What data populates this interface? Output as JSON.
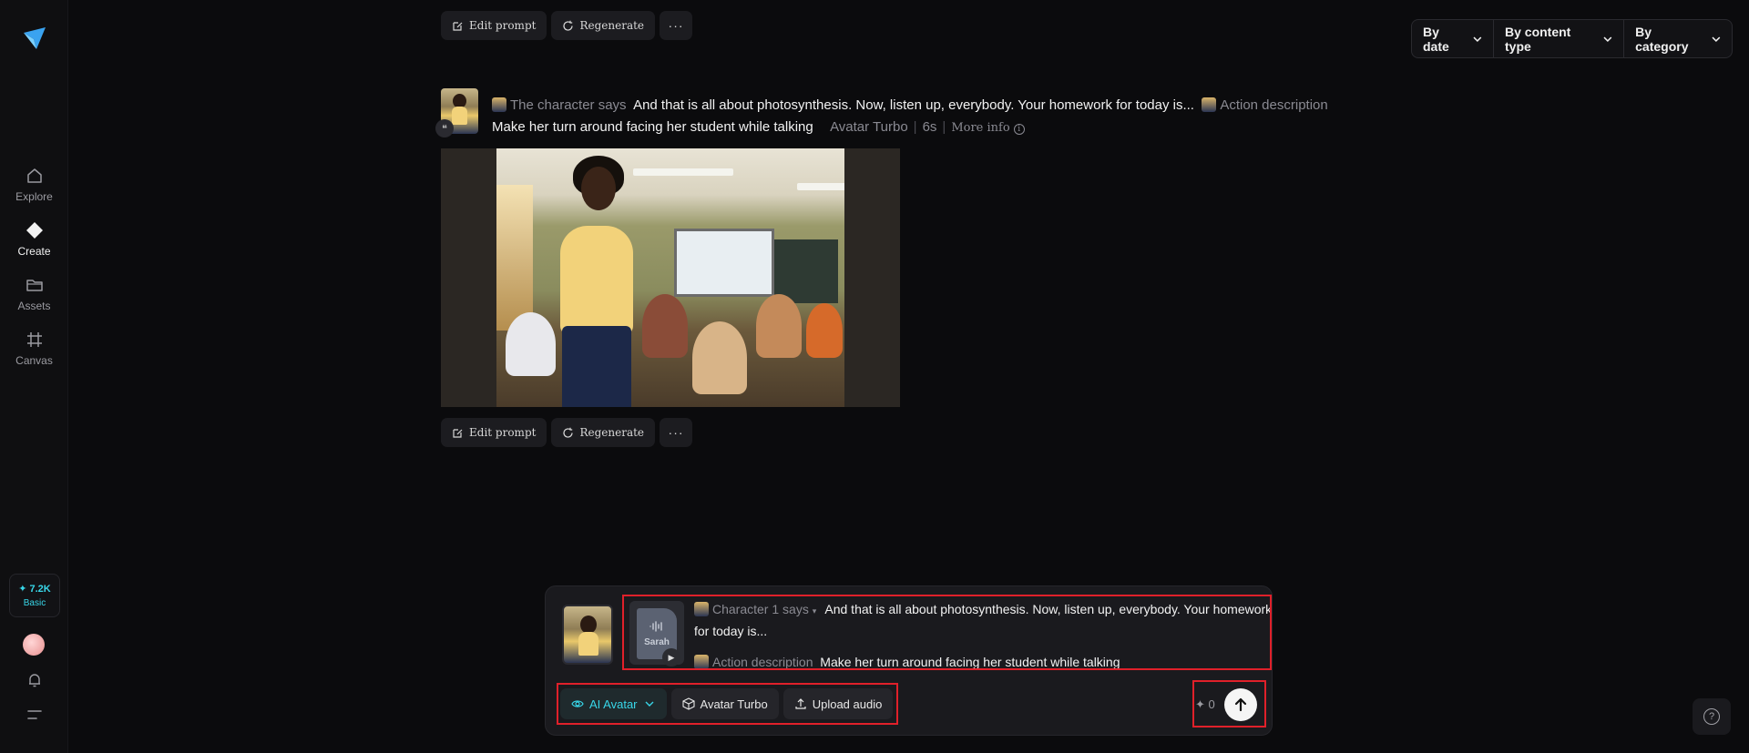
{
  "sidebar": {
    "nav": [
      {
        "label": "Explore",
        "icon": "home-icon"
      },
      {
        "label": "Create",
        "icon": "diamond-icon"
      },
      {
        "label": "Assets",
        "icon": "folder-icon"
      },
      {
        "label": "Canvas",
        "icon": "canvas-icon"
      }
    ],
    "credits": {
      "amount": "✦ 7.2K",
      "plan": "Basic"
    }
  },
  "filters": [
    "By date",
    "By content type",
    "By category"
  ],
  "top_actions": {
    "edit": "Edit prompt",
    "regen": "Regenerate",
    "more": "···"
  },
  "item": {
    "speech_label": "The character says",
    "speech_text": "And that is all about photosynthesis. Now, listen up, everybody. Your homework for today is...",
    "action_label": "Action description",
    "action_text": "Make her turn around facing her student while talking",
    "model": "Avatar Turbo",
    "duration": "6s",
    "more_info": "More info",
    "quote_badge": "❝"
  },
  "bottom_actions": {
    "edit": "Edit prompt",
    "regen": "Regenerate",
    "more": "···"
  },
  "composer": {
    "voice_name": "Sarah",
    "speech_label": "Character 1 says",
    "speech_text": "And that is all about photosynthesis. Now, listen up, everybody. Your homework for today is...",
    "action_label": "Action description",
    "action_text": "Make her turn around facing her student while talking",
    "tools": {
      "mode": "AI Avatar",
      "model": "Avatar Turbo",
      "upload": "Upload audio"
    },
    "cost": "✦ 0"
  },
  "help": "?",
  "colors": {
    "accent": "#38d6e8",
    "highlight": "#e0202a",
    "background": "#0b0b0d"
  }
}
